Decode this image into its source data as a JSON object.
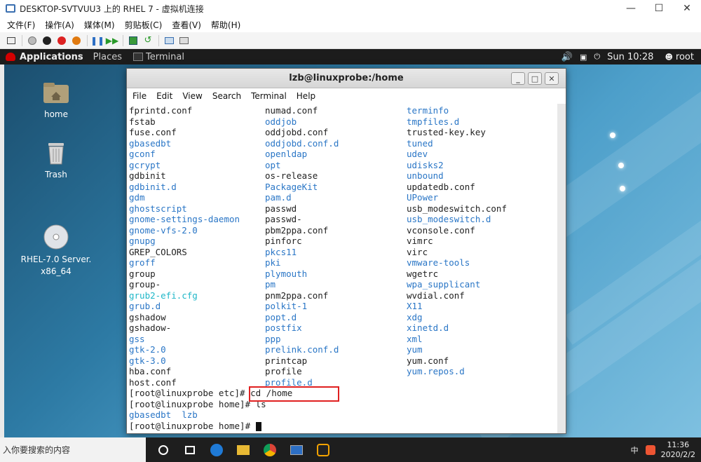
{
  "host": {
    "title": "DESKTOP-SVTVUU3 上的 RHEL 7 - 虚拟机连接",
    "controls": [
      "—",
      "☐",
      "✕"
    ],
    "menu": [
      "文件(F)",
      "操作(A)",
      "媒体(M)",
      "剪贴板(C)",
      "查看(V)",
      "帮助(H)"
    ]
  },
  "guest_bar": {
    "applications": "Applications",
    "places": "Places",
    "terminal": "Terminal",
    "time": "Sun 10:28",
    "user": "root"
  },
  "desktop_icons": [
    {
      "label": "home"
    },
    {
      "label": "Trash"
    },
    {
      "label": "RHEL-7.0 Server.\nx86_64"
    }
  ],
  "terminal": {
    "title": "lzb@linuxprobe:/home",
    "menu": [
      "File",
      "Edit",
      "View",
      "Search",
      "Terminal",
      "Help"
    ],
    "listing": [
      [
        {
          "t": "fprintd.conf",
          "c": "n"
        },
        {
          "t": "numad.conf",
          "c": "n"
        },
        {
          "t": "terminfo",
          "c": "b"
        }
      ],
      [
        {
          "t": "fstab",
          "c": "n"
        },
        {
          "t": "oddjob",
          "c": "b"
        },
        {
          "t": "tmpfiles.d",
          "c": "b"
        }
      ],
      [
        {
          "t": "fuse.conf",
          "c": "n"
        },
        {
          "t": "oddjobd.conf",
          "c": "n"
        },
        {
          "t": "trusted-key.key",
          "c": "n"
        }
      ],
      [
        {
          "t": "gbasedbt",
          "c": "b"
        },
        {
          "t": "oddjobd.conf.d",
          "c": "b"
        },
        {
          "t": "tuned",
          "c": "b"
        }
      ],
      [
        {
          "t": "gconf",
          "c": "b"
        },
        {
          "t": "openldap",
          "c": "b"
        },
        {
          "t": "udev",
          "c": "b"
        }
      ],
      [
        {
          "t": "gcrypt",
          "c": "b"
        },
        {
          "t": "opt",
          "c": "b"
        },
        {
          "t": "udisks2",
          "c": "b"
        }
      ],
      [
        {
          "t": "gdbinit",
          "c": "n"
        },
        {
          "t": "os-release",
          "c": "n"
        },
        {
          "t": "unbound",
          "c": "b"
        }
      ],
      [
        {
          "t": "gdbinit.d",
          "c": "b"
        },
        {
          "t": "PackageKit",
          "c": "b"
        },
        {
          "t": "updatedb.conf",
          "c": "n"
        }
      ],
      [
        {
          "t": "gdm",
          "c": "b"
        },
        {
          "t": "pam.d",
          "c": "b"
        },
        {
          "t": "UPower",
          "c": "b"
        }
      ],
      [
        {
          "t": "ghostscript",
          "c": "b"
        },
        {
          "t": "passwd",
          "c": "n"
        },
        {
          "t": "usb_modeswitch.conf",
          "c": "n"
        }
      ],
      [
        {
          "t": "gnome-settings-daemon",
          "c": "b"
        },
        {
          "t": "passwd-",
          "c": "n"
        },
        {
          "t": "usb_modeswitch.d",
          "c": "b"
        }
      ],
      [
        {
          "t": "gnome-vfs-2.0",
          "c": "b"
        },
        {
          "t": "pbm2ppa.conf",
          "c": "n"
        },
        {
          "t": "vconsole.conf",
          "c": "n"
        }
      ],
      [
        {
          "t": "gnupg",
          "c": "b"
        },
        {
          "t": "pinforc",
          "c": "n"
        },
        {
          "t": "vimrc",
          "c": "n"
        }
      ],
      [
        {
          "t": "GREP_COLORS",
          "c": "n"
        },
        {
          "t": "pkcs11",
          "c": "b"
        },
        {
          "t": "virc",
          "c": "n"
        }
      ],
      [
        {
          "t": "groff",
          "c": "b"
        },
        {
          "t": "pki",
          "c": "b"
        },
        {
          "t": "vmware-tools",
          "c": "b"
        }
      ],
      [
        {
          "t": "group",
          "c": "n"
        },
        {
          "t": "plymouth",
          "c": "b"
        },
        {
          "t": "wgetrc",
          "c": "n"
        }
      ],
      [
        {
          "t": "group-",
          "c": "n"
        },
        {
          "t": "pm",
          "c": "b"
        },
        {
          "t": "wpa_supplicant",
          "c": "b"
        }
      ],
      [
        {
          "t": "grub2-efi.cfg",
          "c": "c"
        },
        {
          "t": "pnm2ppa.conf",
          "c": "n"
        },
        {
          "t": "wvdial.conf",
          "c": "n"
        }
      ],
      [
        {
          "t": "grub.d",
          "c": "b"
        },
        {
          "t": "polkit-1",
          "c": "b"
        },
        {
          "t": "X11",
          "c": "b"
        }
      ],
      [
        {
          "t": "gshadow",
          "c": "n"
        },
        {
          "t": "popt.d",
          "c": "b"
        },
        {
          "t": "xdg",
          "c": "b"
        }
      ],
      [
        {
          "t": "gshadow-",
          "c": "n"
        },
        {
          "t": "postfix",
          "c": "b"
        },
        {
          "t": "xinetd.d",
          "c": "b"
        }
      ],
      [
        {
          "t": "gss",
          "c": "b"
        },
        {
          "t": "ppp",
          "c": "b"
        },
        {
          "t": "xml",
          "c": "b"
        }
      ],
      [
        {
          "t": "gtk-2.0",
          "c": "b"
        },
        {
          "t": "prelink.conf.d",
          "c": "b"
        },
        {
          "t": "yum",
          "c": "b"
        }
      ],
      [
        {
          "t": "gtk-3.0",
          "c": "b"
        },
        {
          "t": "printcap",
          "c": "n"
        },
        {
          "t": "yum.conf",
          "c": "n"
        }
      ],
      [
        {
          "t": "hba.conf",
          "c": "n"
        },
        {
          "t": "profile",
          "c": "n"
        },
        {
          "t": "yum.repos.d",
          "c": "b"
        }
      ],
      [
        {
          "t": "host.conf",
          "c": "n"
        },
        {
          "t": "profile.d",
          "c": "b"
        },
        {
          "t": "",
          "c": "n"
        }
      ]
    ],
    "prompt1": "[root@linuxprobe etc]# ",
    "cmd1": "cd /home",
    "prompt2": "[root@linuxprobe home]# ",
    "cmd2": "ls",
    "ls_out": "gbasedbt  lzb",
    "prompt3": "[root@linuxprobe home]# "
  },
  "taskbar": {
    "search_placeholder": "入你要搜索的内容",
    "tray_ime": "中",
    "clock_time": "11:36",
    "clock_date": "2020/2/2"
  },
  "colors": {
    "link_blue": "#2a76c6",
    "cyan": "#1fb7c8",
    "highlight": "#e02020"
  }
}
